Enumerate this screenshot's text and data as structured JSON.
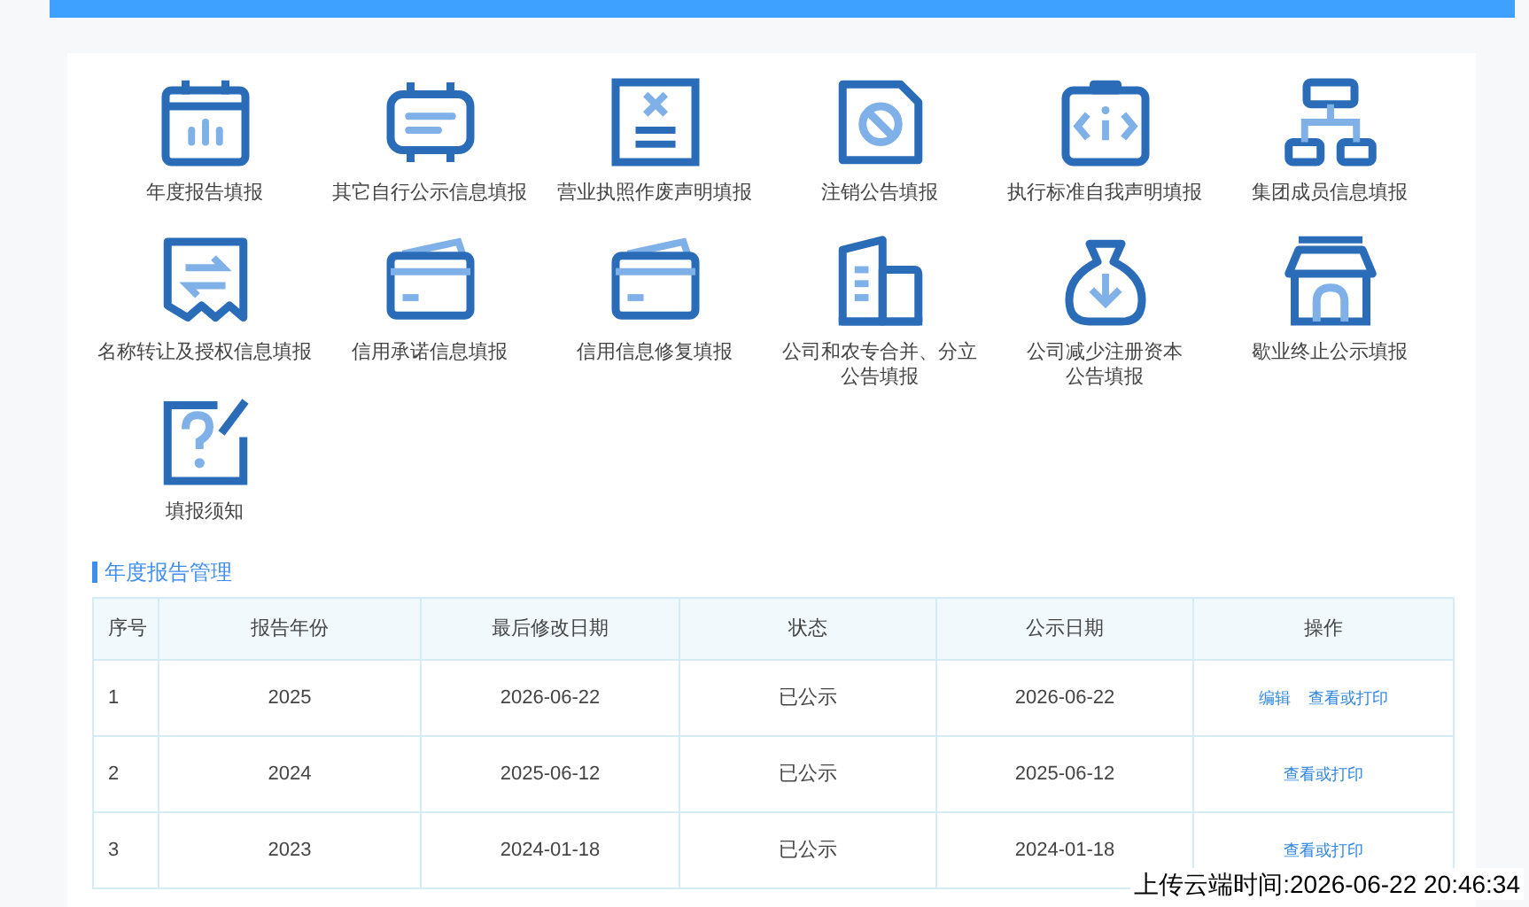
{
  "tiles": [
    {
      "label": "年度报告填报"
    },
    {
      "label": "其它自行公示信息填报"
    },
    {
      "label": "营业执照作废声明填报"
    },
    {
      "label": "注销公告填报"
    },
    {
      "label": "执行标准自我声明填报"
    },
    {
      "label": "集团成员信息填报"
    },
    {
      "label": "名称转让及授权信息填报"
    },
    {
      "label": "信用承诺信息填报"
    },
    {
      "label": "信用信息修复填报"
    },
    {
      "label": "公司和农专合并、分立",
      "label_line_2": "公告填报"
    },
    {
      "label": "公司减少注册资本",
      "label_line_2": "公告填报"
    },
    {
      "label": "歇业终止公示填报"
    },
    {
      "label": "填报须知"
    }
  ],
  "section_title": "年度报告管理",
  "table": {
    "columns": [
      "序号",
      "报告年份",
      "最后修改日期",
      "状态",
      "公示日期",
      "操作"
    ],
    "rows": [
      {
        "cells": [
          "1",
          "2025",
          "2026-06-22",
          "已公示",
          "2026-06-22"
        ],
        "actions": [
          "编辑",
          "查看或打印"
        ]
      },
      {
        "cells": [
          "2",
          "2024",
          "2025-06-12",
          "已公示",
          "2025-06-12"
        ],
        "actions": [
          "查看或打印"
        ]
      },
      {
        "cells": [
          "3",
          "2023",
          "2024-01-18",
          "已公示",
          "2024-01-18"
        ],
        "actions": [
          "查看或打印"
        ]
      }
    ]
  },
  "upload_stamp": "上传云端时间:2026-06-22 20:46:34"
}
